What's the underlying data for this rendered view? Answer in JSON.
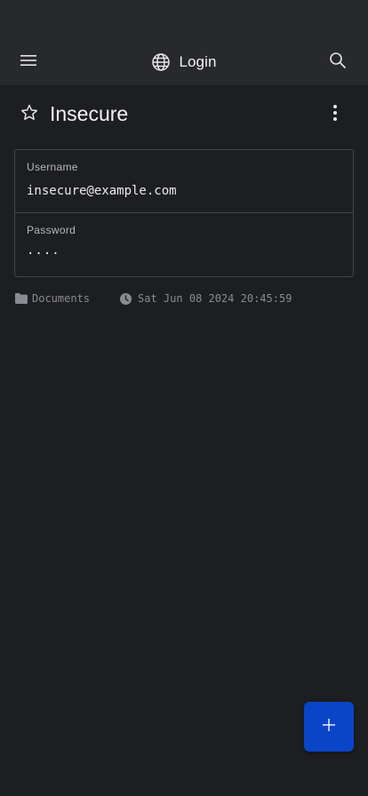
{
  "app_bar": {
    "title": "Login",
    "icons": {
      "menu": "menu-icon",
      "globe": "globe-icon",
      "search": "search-icon"
    }
  },
  "item": {
    "title": "Insecure",
    "favorite_icon": "star-outline-icon",
    "more_icon": "more-vert-icon"
  },
  "fields": {
    "username": {
      "label": "Username",
      "value": "insecure@example.com"
    },
    "password": {
      "label": "Password",
      "value": "····"
    }
  },
  "meta": {
    "folder": "Documents",
    "timestamp": "Sat Jun 08 2024 20:45:59"
  },
  "fab": {
    "icon": "plus-icon"
  },
  "colors": {
    "background": "#1d1e22",
    "app_bar": "#28292d",
    "card_border": "#45464b",
    "accent": "#0a45c7",
    "muted_text": "#8a8b90"
  }
}
